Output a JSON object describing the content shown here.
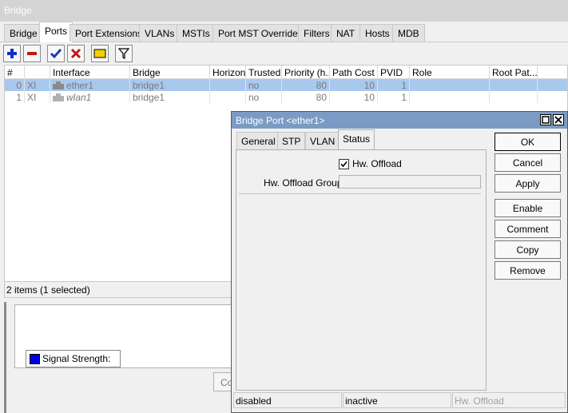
{
  "window": {
    "title": "Bridge"
  },
  "tabs": [
    "Bridge",
    "Ports",
    "Port Extensions",
    "VLANs",
    "MSTIs",
    "Port MST Overrides",
    "Filters",
    "NAT",
    "Hosts",
    "MDB"
  ],
  "toolbar": {
    "icons": [
      "plus-icon",
      "minus-icon",
      "check-icon",
      "x-icon",
      "comment-icon",
      "filter-icon"
    ],
    "colors": {
      "plus": "#1030c8",
      "minus": "#c01818",
      "check": "#1a3db0",
      "x": "#c01818",
      "comment": "#f2d000"
    }
  },
  "table": {
    "columns": [
      "#",
      "",
      "Interface",
      "Bridge",
      "Horizon",
      "Trusted",
      "Priority (h...",
      "Path Cost",
      "PVID",
      "Role",
      "Root Pat..."
    ],
    "rows": [
      {
        "num": "0",
        "flag": "XI",
        "interface": "ether1",
        "bridge": "bridge1",
        "horizon": "",
        "trusted": "no",
        "priority": "80",
        "path_cost": "10",
        "pvid": "1",
        "role": "",
        "root_path": ""
      },
      {
        "num": "1",
        "flag": "XI",
        "interface": "wlan1",
        "bridge": "bridge1",
        "horizon": "",
        "trusted": "no",
        "priority": "80",
        "path_cost": "10",
        "pvid": "1",
        "role": "",
        "root_path": ""
      }
    ],
    "selected_row": 0
  },
  "status": {
    "items": "2 items (1 selected)"
  },
  "lower": {
    "legend_label": "Signal Strength:",
    "legend_color": "#0000e0",
    "partial_button": "Co"
  },
  "dialog": {
    "title": "Bridge Port <ether1>",
    "tabs": [
      "General",
      "STP",
      "VLAN",
      "Status"
    ],
    "active_tab": "Status",
    "hw_offload_label": "Hw. Offload",
    "hw_offload_checked": true,
    "hw_offload_group_label": "Hw. Offload Group:",
    "hw_offload_group_value": "",
    "buttons": [
      "OK",
      "Cancel",
      "Apply",
      "Enable",
      "Comment",
      "Copy",
      "Remove"
    ],
    "status": [
      "disabled",
      "inactive",
      "Hw. Offload"
    ]
  }
}
